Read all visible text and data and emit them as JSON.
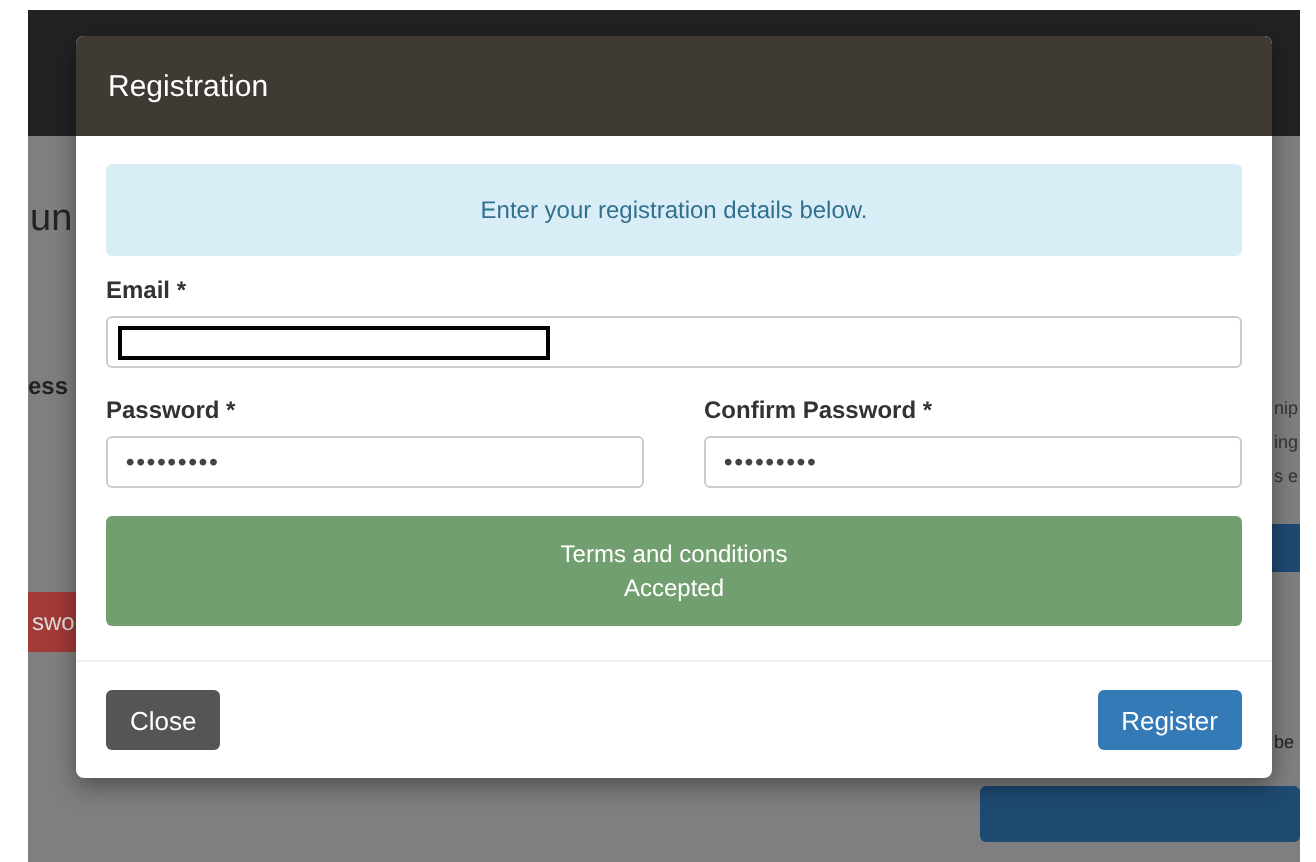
{
  "background_page": {
    "heading_fragment": "un",
    "label_fragment": "ess",
    "button_fragment": "swo",
    "right_fragments": [
      "nip",
      "ing",
      "s e"
    ],
    "right_lower_fragment": "be"
  },
  "modal": {
    "title": "Registration",
    "info": "Enter your registration details below.",
    "fields": [
      {
        "label": "Email *",
        "redacted": true
      },
      {
        "label": "Password *",
        "value": "•••••••••"
      },
      {
        "label": "Confirm Password *",
        "value": "•••••••••"
      }
    ],
    "terms": {
      "title": "Terms and conditions",
      "status": "Accepted",
      "accepted": true
    },
    "buttons": [
      {
        "label": "Close",
        "kind": "secondary"
      },
      {
        "label": "Register",
        "kind": "primary"
      }
    ]
  }
}
